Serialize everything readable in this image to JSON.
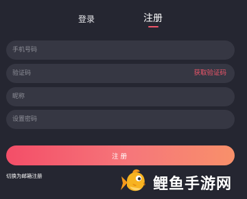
{
  "tabs": {
    "login": "登录",
    "register": "注册",
    "active": "register",
    "accent_color": "#f0566b"
  },
  "form": {
    "phone": {
      "placeholder": "手机号码",
      "value": ""
    },
    "code": {
      "placeholder": "验证码",
      "value": "",
      "get_code_label": "获取验证码"
    },
    "nickname": {
      "placeholder": "昵称",
      "value": ""
    },
    "password": {
      "placeholder": "设置密码",
      "value": ""
    },
    "submit_label": "注册",
    "switch_link": "切换为邮箱注册"
  },
  "watermark": {
    "icon": "fish-logo-icon",
    "text": "鲤鱼手游网"
  },
  "colors": {
    "background": "#252631",
    "field_bg": "#363743",
    "button_gradient_start": "#f34e68",
    "button_gradient_end": "#f8906a"
  }
}
